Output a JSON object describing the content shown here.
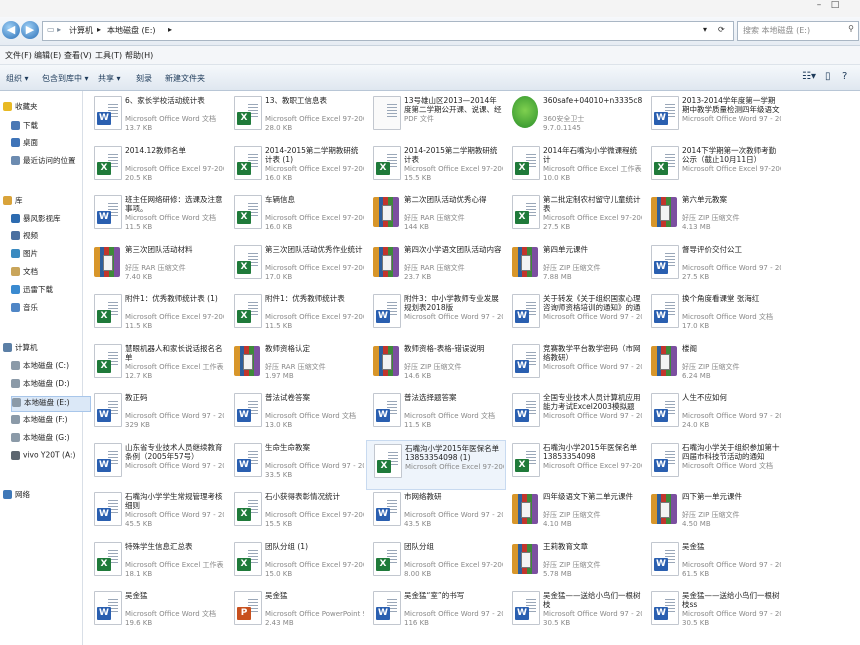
{
  "window": {
    "minimize": "–",
    "maximize": "□"
  },
  "address": {
    "computer": "计算机",
    "drive": "本地磁盘 (E:)"
  },
  "search": {
    "placeholder": "搜索 本地磁盘 (E:)"
  },
  "menu": [
    "文件(F)",
    "编辑(E)",
    "查看(V)",
    "工具(T)",
    "帮助(H)"
  ],
  "toolbar": [
    "组织 ▾",
    "包含到库中 ▾",
    "共享 ▾",
    "刻录",
    "新建文件夹"
  ],
  "nav": [
    {
      "label": "收藏夹",
      "icon": "star-icon",
      "color": "#e8b923"
    },
    {
      "label": "下载",
      "icon": "download-icon",
      "color": "#4a78b5"
    },
    {
      "label": "桌面",
      "icon": "desktop-icon",
      "color": "#3f74b8"
    },
    {
      "label": "最近访问的位置",
      "icon": "recent-icon",
      "color": "#6c8bb0"
    },
    {
      "label": "库",
      "icon": "library-icon",
      "color": "#d9a33a"
    },
    {
      "label": "暴风影视库",
      "icon": "video-library-icon",
      "color": "#2d6bb0"
    },
    {
      "label": "视频",
      "icon": "video-icon",
      "color": "#4a6fa0"
    },
    {
      "label": "图片",
      "icon": "picture-icon",
      "color": "#3a8ac0"
    },
    {
      "label": "文档",
      "icon": "document-icon",
      "color": "#c9a55a"
    },
    {
      "label": "迅雷下载",
      "icon": "download-folder-icon",
      "color": "#3a8ad0"
    },
    {
      "label": "音乐",
      "icon": "music-icon",
      "color": "#4f86c6"
    },
    {
      "label": "计算机",
      "icon": "computer-icon",
      "color": "#5b7fa6"
    },
    {
      "label": "本地磁盘 (C:)",
      "icon": "disk-icon",
      "color": "#8b9aa8"
    },
    {
      "label": "本地磁盘 (D:)",
      "icon": "disk-icon",
      "color": "#8b9aa8"
    },
    {
      "label": "本地磁盘 (E:)",
      "icon": "disk-icon",
      "color": "#8b9aa8"
    },
    {
      "label": "本地磁盘 (F:)",
      "icon": "disk-icon",
      "color": "#8b9aa8"
    },
    {
      "label": "本地磁盘 (G:)",
      "icon": "disk-icon",
      "color": "#8b9aa8"
    },
    {
      "label": "vivo Y20T (A:)",
      "icon": "phone-icon",
      "color": "#5d6670"
    },
    {
      "label": "网络",
      "icon": "network-icon",
      "color": "#3f78b8"
    }
  ],
  "files": [
    {
      "name": "6、家长学校活动统计表",
      "type": "Microsoft Office Word 文档",
      "size": "13.7 KB",
      "kind": "word"
    },
    {
      "name": "13、教职工信息表",
      "type": "Microsoft Office Excel 97-2003...",
      "size": "28.0 KB",
      "kind": "excel"
    },
    {
      "name": "13号雄山区2013—2014年度第二学期公开课、说课、经验交流...",
      "type": "PDF 文件",
      "size": "",
      "kind": "pdf"
    },
    {
      "name": "360safe+04010+n3335c8fd8f",
      "type": "360安全卫士",
      "size": "9.7.0.1145",
      "kind": "exe"
    },
    {
      "name": "2013-2014学年度第一学期期中教学质量检测四年级语文试卷",
      "type": "Microsoft Office Word 97 - 20...",
      "size": "",
      "kind": "word"
    },
    {
      "name": "2014.12教师名单",
      "type": "Microsoft Office Excel 97-2003...",
      "size": "20.5 KB",
      "kind": "excel"
    },
    {
      "name": "2014-2015第二学期教研统计表 (1)",
      "type": "Microsoft Office Excel 97-2003...",
      "size": "16.0 KB",
      "kind": "excel"
    },
    {
      "name": "2014-2015第二学期教研统计表",
      "type": "Microsoft Office Excel 97-2003...",
      "size": "15.5 KB",
      "kind": "excel"
    },
    {
      "name": "2014年石嘴沟小学微课程统计",
      "type": "Microsoft Office Excel 工作表",
      "size": "10.0 KB",
      "kind": "excel"
    },
    {
      "name": "2014下学期第一次教师考勤公示（截止10月11日）",
      "type": "Microsoft Office Excel 97-2003...",
      "size": "",
      "kind": "excel"
    },
    {
      "name": "班主任网络研修：选课及注意事项。",
      "type": "Microsoft Office Word 文档",
      "size": "11.5 KB",
      "kind": "word"
    },
    {
      "name": "车辆信息",
      "type": "Microsoft Office Excel 97-2003...",
      "size": "16.0 KB",
      "kind": "excel"
    },
    {
      "name": "第二次团队活动优秀心得",
      "type": "好压 RAR 压缩文件",
      "size": "144 KB",
      "kind": "rar"
    },
    {
      "name": "第二批定制农村留守儿童统计表",
      "type": "Microsoft Office Excel 97-2003...",
      "size": "27.5 KB",
      "kind": "excel"
    },
    {
      "name": "第六单元教案",
      "type": "好压 ZIP 压缩文件",
      "size": "4.13 MB",
      "kind": "rar"
    },
    {
      "name": "第三次团队活动材料",
      "type": "好压 RAR 压缩文件",
      "size": "7.40 KB",
      "kind": "rar"
    },
    {
      "name": "第三次团队活动优秀作业统计",
      "type": "Microsoft Office Excel 97-2003...",
      "size": "17.0 KB",
      "kind": "excel"
    },
    {
      "name": "第四次小学语文团队活动内容",
      "type": "好压 RAR 压缩文件",
      "size": "23.7 KB",
      "kind": "rar"
    },
    {
      "name": "第四单元课件",
      "type": "好压 ZIP 压缩文件",
      "size": "7.88 MB",
      "kind": "rar"
    },
    {
      "name": "督导评价交付公工",
      "type": "Microsoft Office Word 97 - 20...",
      "size": "27.5 KB",
      "kind": "word"
    },
    {
      "name": "附件1：优秀教师统计表 (1)",
      "type": "Microsoft Office Excel 97-2003...",
      "size": "11.5 KB",
      "kind": "excel"
    },
    {
      "name": "附件1：优秀教师统计表",
      "type": "Microsoft Office Excel 97-2003...",
      "size": "11.5 KB",
      "kind": "excel"
    },
    {
      "name": "附件3：中小学教师专业发展规划表2018版",
      "type": "Microsoft Office Word 97 - 20...",
      "size": "",
      "kind": "word"
    },
    {
      "name": "关于转发《关于组织国家心理咨询师资格培训的通知》的通知",
      "type": "Microsoft Office Word 97 - 20...",
      "size": "",
      "kind": "word"
    },
    {
      "name": "换个角度看课堂 张海红",
      "type": "Microsoft Office Word 文档",
      "size": "17.0 KB",
      "kind": "word"
    },
    {
      "name": "慧眼机器人和家长说话报名名单",
      "type": "Microsoft Office Excel 工作表",
      "size": "12.7 KB",
      "kind": "excel"
    },
    {
      "name": "教师资格认定",
      "type": "好压 RAR 压缩文件",
      "size": "1.97 MB",
      "kind": "rar"
    },
    {
      "name": "教师资格-表格-错误说明",
      "type": "好压 ZIP 压缩文件",
      "size": "14.6 KB",
      "kind": "rar"
    },
    {
      "name": "竞赛教学平台教学密码（市网络教研）",
      "type": "Microsoft Office Word 97 - 20...",
      "size": "",
      "kind": "word"
    },
    {
      "name": "楼阁",
      "type": "好压 ZIP 压缩文件",
      "size": "6.24 MB",
      "kind": "rar"
    },
    {
      "name": "教正码",
      "type": "Microsoft Office Word 97 - 20...",
      "size": "329 KB",
      "kind": "word"
    },
    {
      "name": "普法试卷答案",
      "type": "Microsoft Office Word 文档",
      "size": "13.0 KB",
      "kind": "word"
    },
    {
      "name": "普法选择题答案",
      "type": "Microsoft Office Word 文档",
      "size": "11.5 KB",
      "kind": "word"
    },
    {
      "name": "全国专业技术人员计算机应用能力考试Excel2003模拟题",
      "type": "Microsoft Office Word 97 - 20...",
      "size": "",
      "kind": "word"
    },
    {
      "name": "人生不应如何",
      "type": "Microsoft Office Word 97 - 20...",
      "size": "24.0 KB",
      "kind": "word"
    },
    {
      "name": "山东省专业技术人员继续教育条例（2005年57号）",
      "type": "Microsoft Office Word 97 - 20...",
      "size": "",
      "kind": "word"
    },
    {
      "name": "生命生命教案",
      "type": "Microsoft Office Word 97 - 20...",
      "size": "33.5 KB",
      "kind": "word"
    },
    {
      "name": "石嘴沟小学2015年医保名单13853354098 (1)",
      "type": "Microsoft Office Excel 97-2003...",
      "size": "",
      "kind": "excel",
      "highlight": true
    },
    {
      "name": "石嘴沟小学2015年医保名单13853354098",
      "type": "Microsoft Office Excel 97-2003...",
      "size": "",
      "kind": "excel"
    },
    {
      "name": "石嘴沟小学关于组织参加第十四届市科技节活动的通知",
      "type": "Microsoft Office Word 文档",
      "size": "",
      "kind": "word"
    },
    {
      "name": "石嘴沟小学学生常规管理考核细则",
      "type": "Microsoft Office Word 97 - 20...",
      "size": "45.5 KB",
      "kind": "word"
    },
    {
      "name": "石小获得表彰情况统计",
      "type": "Microsoft Office Excel 97-2003...",
      "size": "15.5 KB",
      "kind": "excel"
    },
    {
      "name": "市网络教研",
      "type": "Microsoft Office Word 97 - 20...",
      "size": "43.5 KB",
      "kind": "word"
    },
    {
      "name": "四年级语文下第二单元课件",
      "type": "好压 ZIP 压缩文件",
      "size": "4.10 MB",
      "kind": "rar"
    },
    {
      "name": "四下第一单元课件",
      "type": "好压 ZIP 压缩文件",
      "size": "4.50 MB",
      "kind": "rar"
    },
    {
      "name": "特殊学生信息汇总表",
      "type": "Microsoft Office Excel 工作表",
      "size": "18.1 KB",
      "kind": "excel"
    },
    {
      "name": "团队分组 (1)",
      "type": "Microsoft Office Excel 97-2003...",
      "size": "15.0 KB",
      "kind": "excel"
    },
    {
      "name": "团队分组",
      "type": "Microsoft Office Excel 97-2003...",
      "size": "8.00 KB",
      "kind": "excel"
    },
    {
      "name": "王莉教育文章",
      "type": "好压 ZIP 压缩文件",
      "size": "5.78 MB",
      "kind": "rar"
    },
    {
      "name": "吴金猛",
      "type": "Microsoft Office Word 97 - 20...",
      "size": "61.5 KB",
      "kind": "word"
    },
    {
      "name": "吴金猛",
      "type": "Microsoft Office Word 文档",
      "size": "19.6 KB",
      "kind": "word"
    },
    {
      "name": "吴金猛",
      "type": "Microsoft Office PowerPoint 9...",
      "size": "2.43 MB",
      "kind": "ppt"
    },
    {
      "name": "吴金猛“室”的书写",
      "type": "Microsoft Office Word 97 - 20...",
      "size": "116 KB",
      "kind": "word"
    },
    {
      "name": "吴金猛——送给小鸟们一根树枝",
      "type": "Microsoft Office Word 97 - 20...",
      "size": "30.5 KB",
      "kind": "word"
    },
    {
      "name": "吴金猛——送给小鸟们一根树枝ss",
      "type": "Microsoft Office Word 97 - 20...",
      "size": "30.5 KB",
      "kind": "word"
    }
  ]
}
